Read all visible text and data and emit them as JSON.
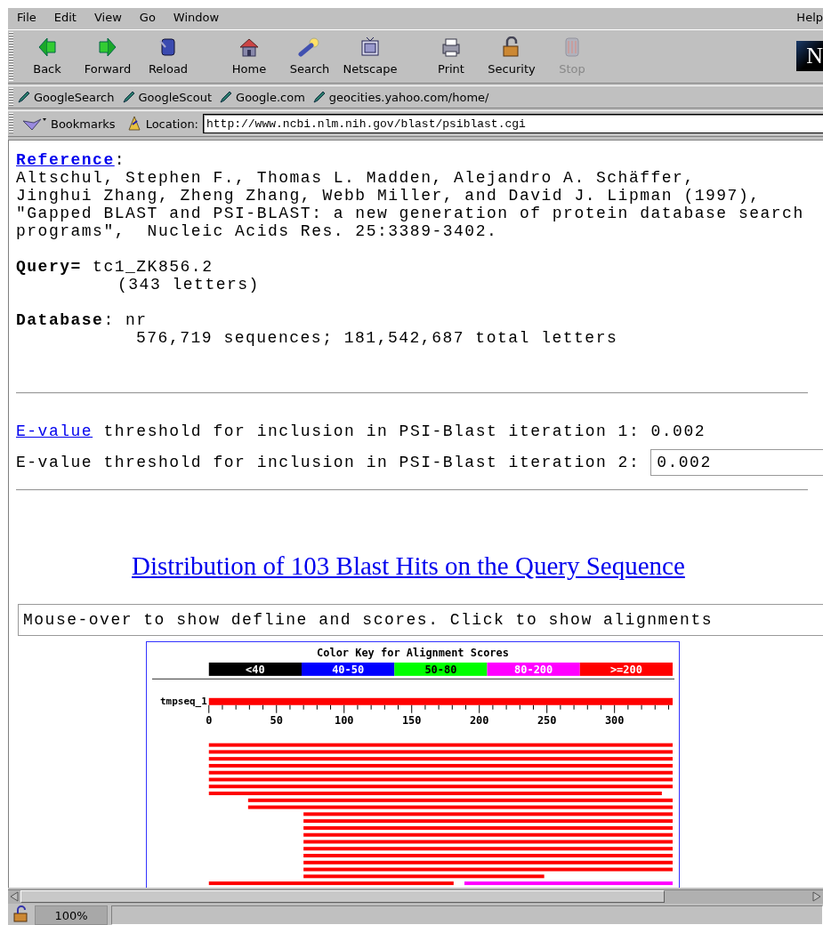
{
  "menu_bar": {
    "items": [
      "File",
      "Edit",
      "View",
      "Go",
      "Window"
    ],
    "help": "Help"
  },
  "navigation_toolbar": {
    "buttons": [
      {
        "label": "Back",
        "disabled": false
      },
      {
        "label": "Forward",
        "disabled": false
      },
      {
        "label": "Reload",
        "disabled": false
      },
      {
        "label": "Home",
        "disabled": false
      },
      {
        "label": "Search",
        "disabled": false
      },
      {
        "label": "Netscape",
        "disabled": false
      },
      {
        "label": "Print",
        "disabled": false
      },
      {
        "label": "Security",
        "disabled": false
      },
      {
        "label": "Stop",
        "disabled": true
      }
    ],
    "logo": "N"
  },
  "personal_toolbar": {
    "items": [
      "GoogleSearch",
      "GoogleScout",
      "Google.com",
      "geocities.yahoo.com/home/"
    ]
  },
  "location_bar": {
    "bookmarks_label": "Bookmarks",
    "location_label": "Location:",
    "url": "http://www.ncbi.nlm.nih.gov/blast/psiblast.cgi"
  },
  "document": {
    "reference": {
      "link": "Reference",
      "colon": ":",
      "lines": [
        "Altschul, Stephen F., Thomas L. Madden, Alejandro A. Schäffer,",
        "Jinghui Zhang, Zheng Zhang, Webb Miller, and David J. Lipman (1997),",
        "\"Gapped BLAST and PSI-BLAST: a new generation of protein database search",
        "programs\",  Nucleic Acids Res. 25:3389-3402."
      ]
    },
    "query": {
      "line": "**Query=** tc1_ZK856.2",
      "length": "(343 letters)"
    },
    "database": {
      "line": "**Database**: nr",
      "stats": "576,719 sequences; 181,542,687 total letters"
    },
    "evalue_1": {
      "link": "E-value",
      "text": "threshold for inclusion in PSI-Blast iteration 1: 0.002"
    },
    "evalue_2": {
      "label": "E-value threshold for inclusion in PSI-Blast iteration 2:",
      "value": "0.002"
    },
    "heading": "Distribution of 103 Blast Hits on the Query Sequence",
    "mouseover_field": {
      "value": "Mouse-over to show defline and scores. Click to show alignments"
    },
    "graphic": {
      "color_key": {
        "title": "Color Key for Alignment Scores",
        "ranges": [
          {
            "label": "<40",
            "color": "#000000"
          },
          {
            "label": "40-50",
            "color": "#0000ff"
          },
          {
            "label": "50-80",
            "color": "#00ff00"
          },
          {
            "label": "80-200",
            "color": "#ff00ff"
          },
          {
            "label": ">=200",
            "color": "#ff0000"
          }
        ]
      },
      "sequence_label": "tmpseq_1",
      "axis_labels": [
        "0",
        "50",
        "100",
        "150",
        "200",
        "250",
        "300"
      ]
    }
  },
  "status_bar": {
    "zoom": "100%"
  }
}
